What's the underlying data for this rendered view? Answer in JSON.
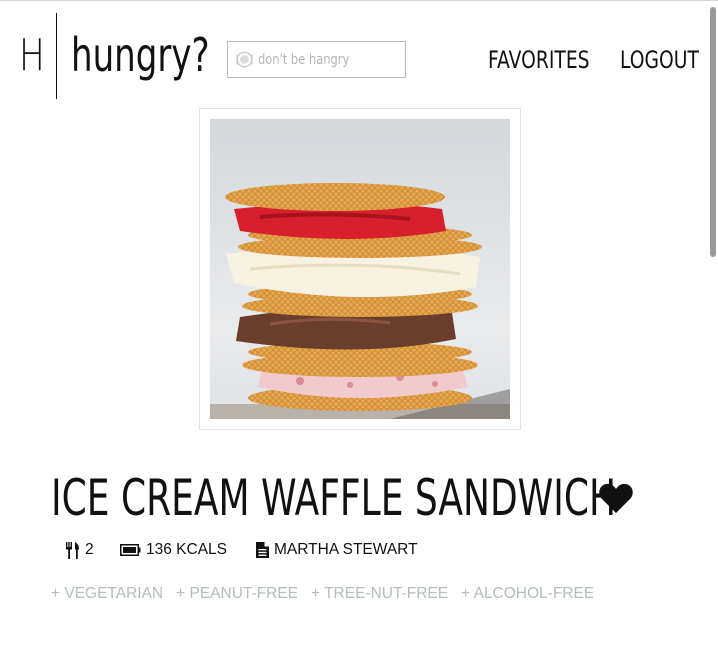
{
  "header": {
    "logo_letter": "H",
    "logo_word": "hungry?",
    "search": {
      "placeholder": "don't be hangry",
      "value": ""
    },
    "nav": {
      "favorites": "FAVORITES",
      "logout": "LOGOUT"
    }
  },
  "recipe": {
    "title": "ICE CREAM WAFFLE SANDWICH",
    "servings": "2",
    "kcals": "136 KCALS",
    "author": "MARTHA STEWART",
    "tags": [
      "+ VEGETARIAN",
      "+ PEANUT-FREE",
      "+ TREE-NUT-FREE",
      "+ ALCOHOL-FREE"
    ],
    "favorited": true
  },
  "icons": {
    "search": "plate-icon",
    "servings": "utensils-icon",
    "kcals": "battery-icon",
    "author": "document-icon",
    "favorite": "heart-icon"
  },
  "colors": {
    "text": "#111111",
    "tag_text": "#b4bdbd",
    "border": "#b8b8b8"
  }
}
